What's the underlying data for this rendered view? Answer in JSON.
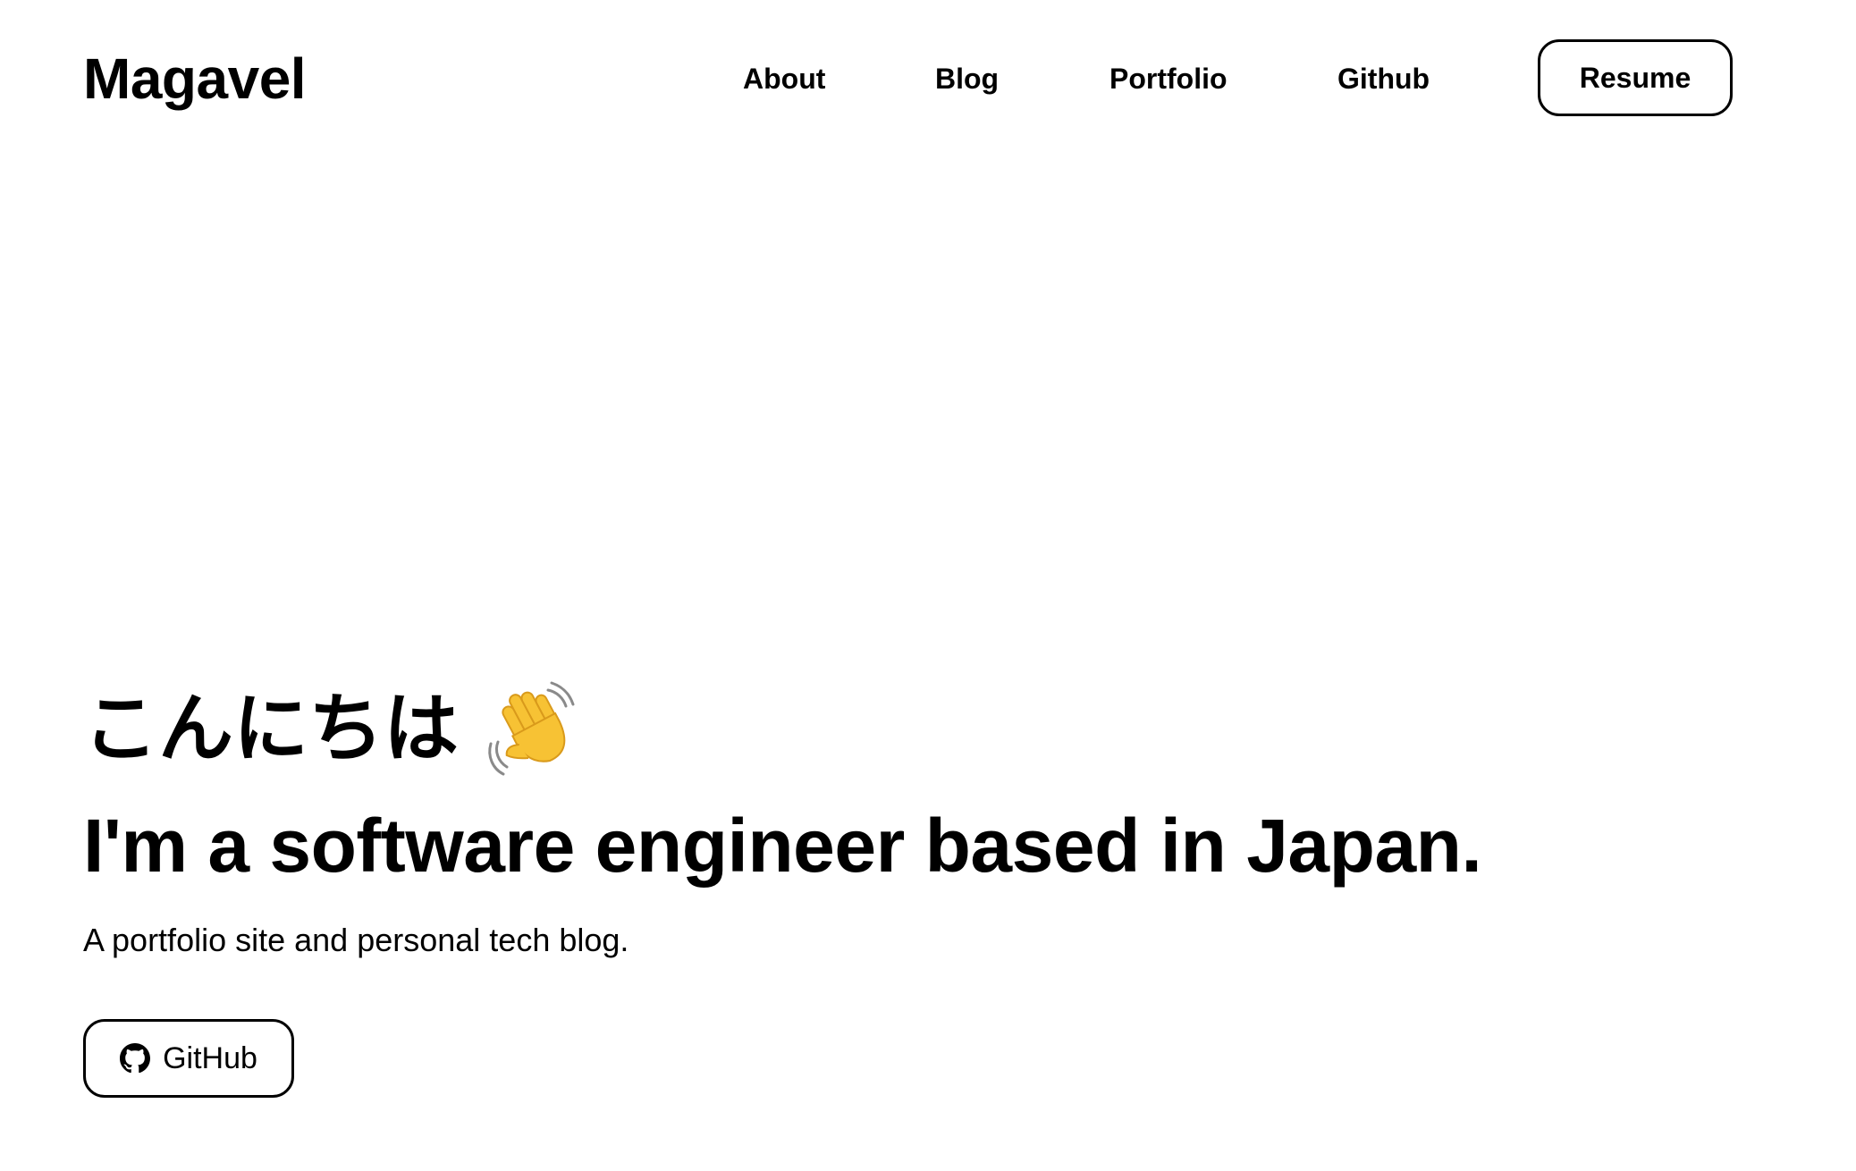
{
  "header": {
    "logo": "Magavel",
    "nav": [
      {
        "label": "About"
      },
      {
        "label": "Blog"
      },
      {
        "label": "Portfolio"
      },
      {
        "label": "Github"
      }
    ],
    "resume_label": "Resume"
  },
  "hero": {
    "greeting": "こんにちは",
    "greeting_icon": "waving-hand-icon",
    "headline": "I'm a software engineer based in Japan.",
    "subtitle": "A portfolio site and personal tech blog.",
    "github_button": {
      "label": "GitHub",
      "icon": "github-icon"
    }
  },
  "colors": {
    "text": "#000000",
    "background": "#ffffff",
    "wave_hand": "#F7C234"
  }
}
